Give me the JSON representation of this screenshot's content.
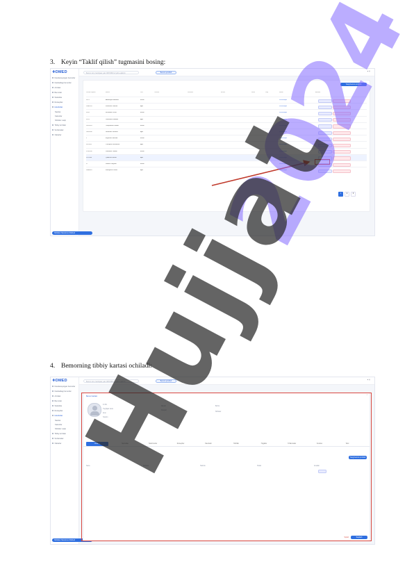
{
  "steps": [
    {
      "number": "3.",
      "text": "Keyin “Taklif qilish” tugmasini bosing:"
    },
    {
      "number": "4.",
      "text": "Bemorning tibbiy kartasi ochiladi:"
    }
  ],
  "app": {
    "logo": "DMED",
    "sidebar": [
      {
        "label": "Davolanayotgan bemorlar"
      },
      {
        "label": "Navbatdagi bemorlar"
      },
      {
        "label": "Arizalar"
      },
      {
        "label": "Bemorlar"
      },
      {
        "label": "Statistika"
      },
      {
        "label": "Retseptlar"
      },
      {
        "label": "Hisobotlar"
      },
      {
        "label": "Navbat"
      },
      {
        "label": "Kalendar"
      },
      {
        "label": "Shifokor vaqti"
      },
      {
        "label": "Tibbiy ko'riklar"
      },
      {
        "label": "Sozlamalar"
      },
      {
        "label": "Xabarlar"
      }
    ],
    "user_pill": "Shifokor Muminov Dilshod",
    "search_placeholder": "Bemor ismi, familiyasi yoki JSHSHIR bo'yicha qidirish",
    "top_button": "Bemor qo'shish",
    "add_button": "Yangi bemor qo'shish"
  },
  "shot1": {
    "columns": [
      "Davlat raqami",
      "Bemor",
      "Jinsi",
      "Telefon",
      "Shifokor",
      "Bo'lim",
      "Sana",
      "Vaqt",
      "Holati",
      "Amallar"
    ],
    "rows": [
      {
        "id": "1121",
        "name": "Abdullayev Azizbek",
        "sex": "Erkak",
        "status": "Kutilmoqda"
      },
      {
        "id": "1340124",
        "name": "Karimova Dilnoza",
        "sex": "Ayol",
        "status": "Kutilmoqda"
      },
      {
        "id": "1124",
        "name": "Rustamov Jasur",
        "sex": "Erkak",
        "status": "Kutilmoqda"
      },
      {
        "id": "1125",
        "name": "Usmonova Madina",
        "sex": "Ayol",
        "status": "Kutilmoqda"
      },
      {
        "id": "1261214",
        "name": "Toshpulatov Sardor",
        "sex": "Erkak",
        "status": "Kutilmoqda"
      },
      {
        "id": "1361200",
        "name": "Nazarova Gulnora",
        "sex": "Ayol",
        "status": "Kutilmoqda"
      },
      {
        "id": "1",
        "name": "Ergashev Bekzod",
        "sex": "Erkak",
        "status": "Kutilmoqda"
      },
      {
        "id": "1151121",
        "name": "Yusupova Shahnoza",
        "sex": "Ayol",
        "status": "Kutilmoqda"
      },
      {
        "id": "1210100",
        "name": "Xolmatov Otabek",
        "sex": "Erkak",
        "status": "Kutilmoqda"
      },
      {
        "id": "1141144",
        "name": "Qodirova Nilufar",
        "sex": "Ayol",
        "status": "Kutilmoqda"
      },
      {
        "id": "12",
        "name": "Saidov Ulug'bek",
        "sex": "Erkak",
        "status": "Kutilmoqda"
      },
      {
        "id": "1890010",
        "name": "Mirzayeva Feruza",
        "sex": "Ayol",
        "status": "Kutilmoqda"
      }
    ],
    "action1": "Taklif qilish",
    "action2": "Bekor qilish",
    "pages": [
      "1",
      "2",
      "3"
    ]
  },
  "shot2": {
    "patient_header": "Bemor kartasi",
    "labels": [
      "F.I.Sh.",
      "Tug'ilgan sana",
      "Jinsi",
      "Telefon",
      "Manzil",
      "Pasport",
      "Bo'lim",
      "Shifokor"
    ],
    "tabs": [
      "Umumiy",
      "Tashxislar",
      "Tekshiruvlar",
      "Retseptlar",
      "Davolash",
      "Tahlillar",
      "Hujjatlar",
      "Yo'llanmalar",
      "Kuzatuv",
      "Tarix"
    ],
    "table_cols": [
      "Sana",
      "Shifokor",
      "Tashxis",
      "Holati",
      "Amallar"
    ],
    "footer_btn": "Saqlash",
    "footer_link": "Yopish"
  },
  "watermark": "Hujjat",
  "watermark_top": "2024"
}
